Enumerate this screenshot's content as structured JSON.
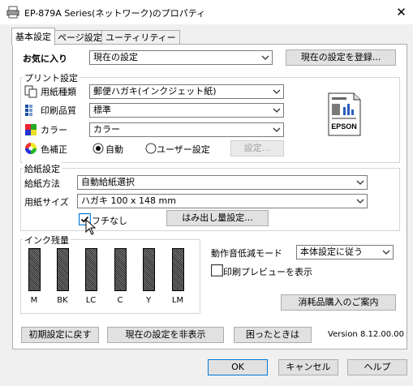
{
  "window": {
    "title": "EP-879A Series(ネットワーク)のプロパティ"
  },
  "tabs": [
    "基本設定",
    "ページ設定",
    "ユーティリティー"
  ],
  "favorites": {
    "label": "お気に入り",
    "value": "現在の設定",
    "register_button": "現在の設定を登録..."
  },
  "print_settings": {
    "group_label": "プリント設定",
    "paper_type_label": "用紙種類",
    "paper_type_value": "郵便ハガキ(インクジェット紙)",
    "quality_label": "印刷品質",
    "quality_value": "標準",
    "color_label": "カラー",
    "color_value": "カラー",
    "color_correction_label": "色補正",
    "auto_label": "自動",
    "user_label": "ユーザー設定",
    "settings_button": "設定...",
    "brand": "EPSON"
  },
  "feed_settings": {
    "group_label": "給紙設定",
    "feed_method_label": "給紙方法",
    "feed_method_value": "自動給紙選択",
    "paper_size_label": "用紙サイズ",
    "paper_size_value": "ハガキ 100 x 148 mm",
    "borderless_label": "フチなし",
    "overflow_button": "はみ出し量設定..."
  },
  "ink": {
    "group_label": "インク残量",
    "cartridges": [
      "M",
      "BK",
      "LC",
      "C",
      "Y",
      "LM"
    ]
  },
  "quiet_mode": {
    "label": "動作音低減モード",
    "value": "本体設定に従う"
  },
  "preview": {
    "label": "印刷プレビューを表示"
  },
  "supplies_button": "消耗品購入のご案内",
  "bottom_buttons": {
    "reset": "初期設定に戻す",
    "hide": "現在の設定を非表示",
    "help_trouble": "困ったときは"
  },
  "version": "Version 8.12.00.00",
  "dialog_buttons": {
    "ok": "OK",
    "cancel": "キャンセル",
    "help": "ヘルプ"
  }
}
